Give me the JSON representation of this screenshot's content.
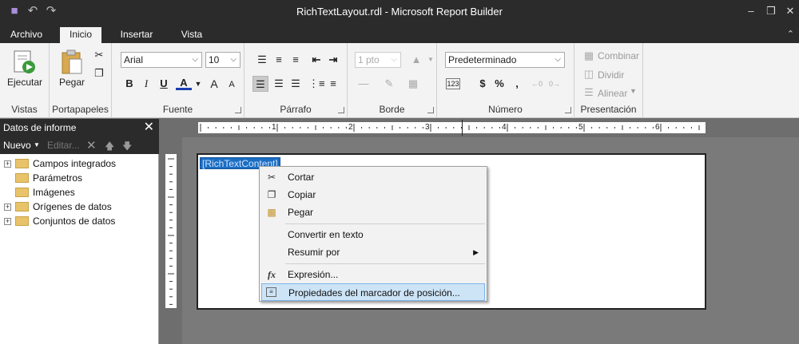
{
  "window": {
    "title": "RichTextLayout.rdl - Microsoft Report Builder",
    "controls": [
      "minimize-icon",
      "restore-icon",
      "close-icon"
    ]
  },
  "quick_access": [
    "save-icon",
    "undo-icon",
    "redo-icon"
  ],
  "tabs": [
    {
      "label": "Archivo",
      "active": false
    },
    {
      "label": "Inicio",
      "active": true
    },
    {
      "label": "Insertar",
      "active": false
    },
    {
      "label": "Vista",
      "active": false
    }
  ],
  "ribbon": {
    "vistas": {
      "run_label": "Ejecutar",
      "group_label": "Vistas"
    },
    "portapapeles": {
      "paste_label": "Pegar",
      "group_label": "Portapapeles"
    },
    "fuente": {
      "font_value": "Arial",
      "size_value": "10",
      "group_label": "Fuente",
      "buttons": [
        "B",
        "I",
        "U",
        "A",
        "A",
        "A"
      ]
    },
    "parrafo": {
      "group_label": "Párrafo"
    },
    "borde": {
      "width_value": "1 pto",
      "group_label": "Borde"
    },
    "numero": {
      "format_value": "Predeterminado",
      "currency": "$",
      "percent": "%",
      "comma": ",",
      "group_label": "Número"
    },
    "presentacion": {
      "merge_label": "Combinar",
      "split_label": "Dividir",
      "align_label": "Alinear",
      "group_label": "Presentación"
    }
  },
  "report_data_panel": {
    "title": "Datos de informe",
    "new_label": "Nuevo",
    "edit_label": "Editar...",
    "items": [
      {
        "label": "Campos integrados",
        "expandable": true
      },
      {
        "label": "Parámetros",
        "expandable": false
      },
      {
        "label": "Imágenes",
        "expandable": false
      },
      {
        "label": "Orígenes de datos",
        "expandable": true
      },
      {
        "label": "Conjuntos de datos",
        "expandable": true
      }
    ]
  },
  "ruler": {
    "numbers": [
      "1",
      "2",
      "3",
      "4",
      "5",
      "6"
    ]
  },
  "design": {
    "placeholder_text": "[RichTextContent]"
  },
  "context_menu": {
    "items": [
      {
        "label": "Cortar",
        "icon": "scissors-icon"
      },
      {
        "label": "Copiar",
        "icon": "copy-icon"
      },
      {
        "label": "Pegar",
        "icon": "paste-icon"
      },
      {
        "label": "Convertir en texto",
        "icon": ""
      },
      {
        "label": "Resumir por",
        "icon": "",
        "submenu": true
      },
      {
        "label": "Expresión...",
        "icon": "fx-icon"
      },
      {
        "label": "Propiedades del marcador de posición...",
        "icon": "properties-icon",
        "highlighted": true
      }
    ]
  },
  "colors": {
    "chrome_dark": "#2b2b2b",
    "ribbon_bg": "#f3f3f3",
    "selection_blue": "#1b6ec2",
    "menu_highlight": "#cde4f7"
  }
}
